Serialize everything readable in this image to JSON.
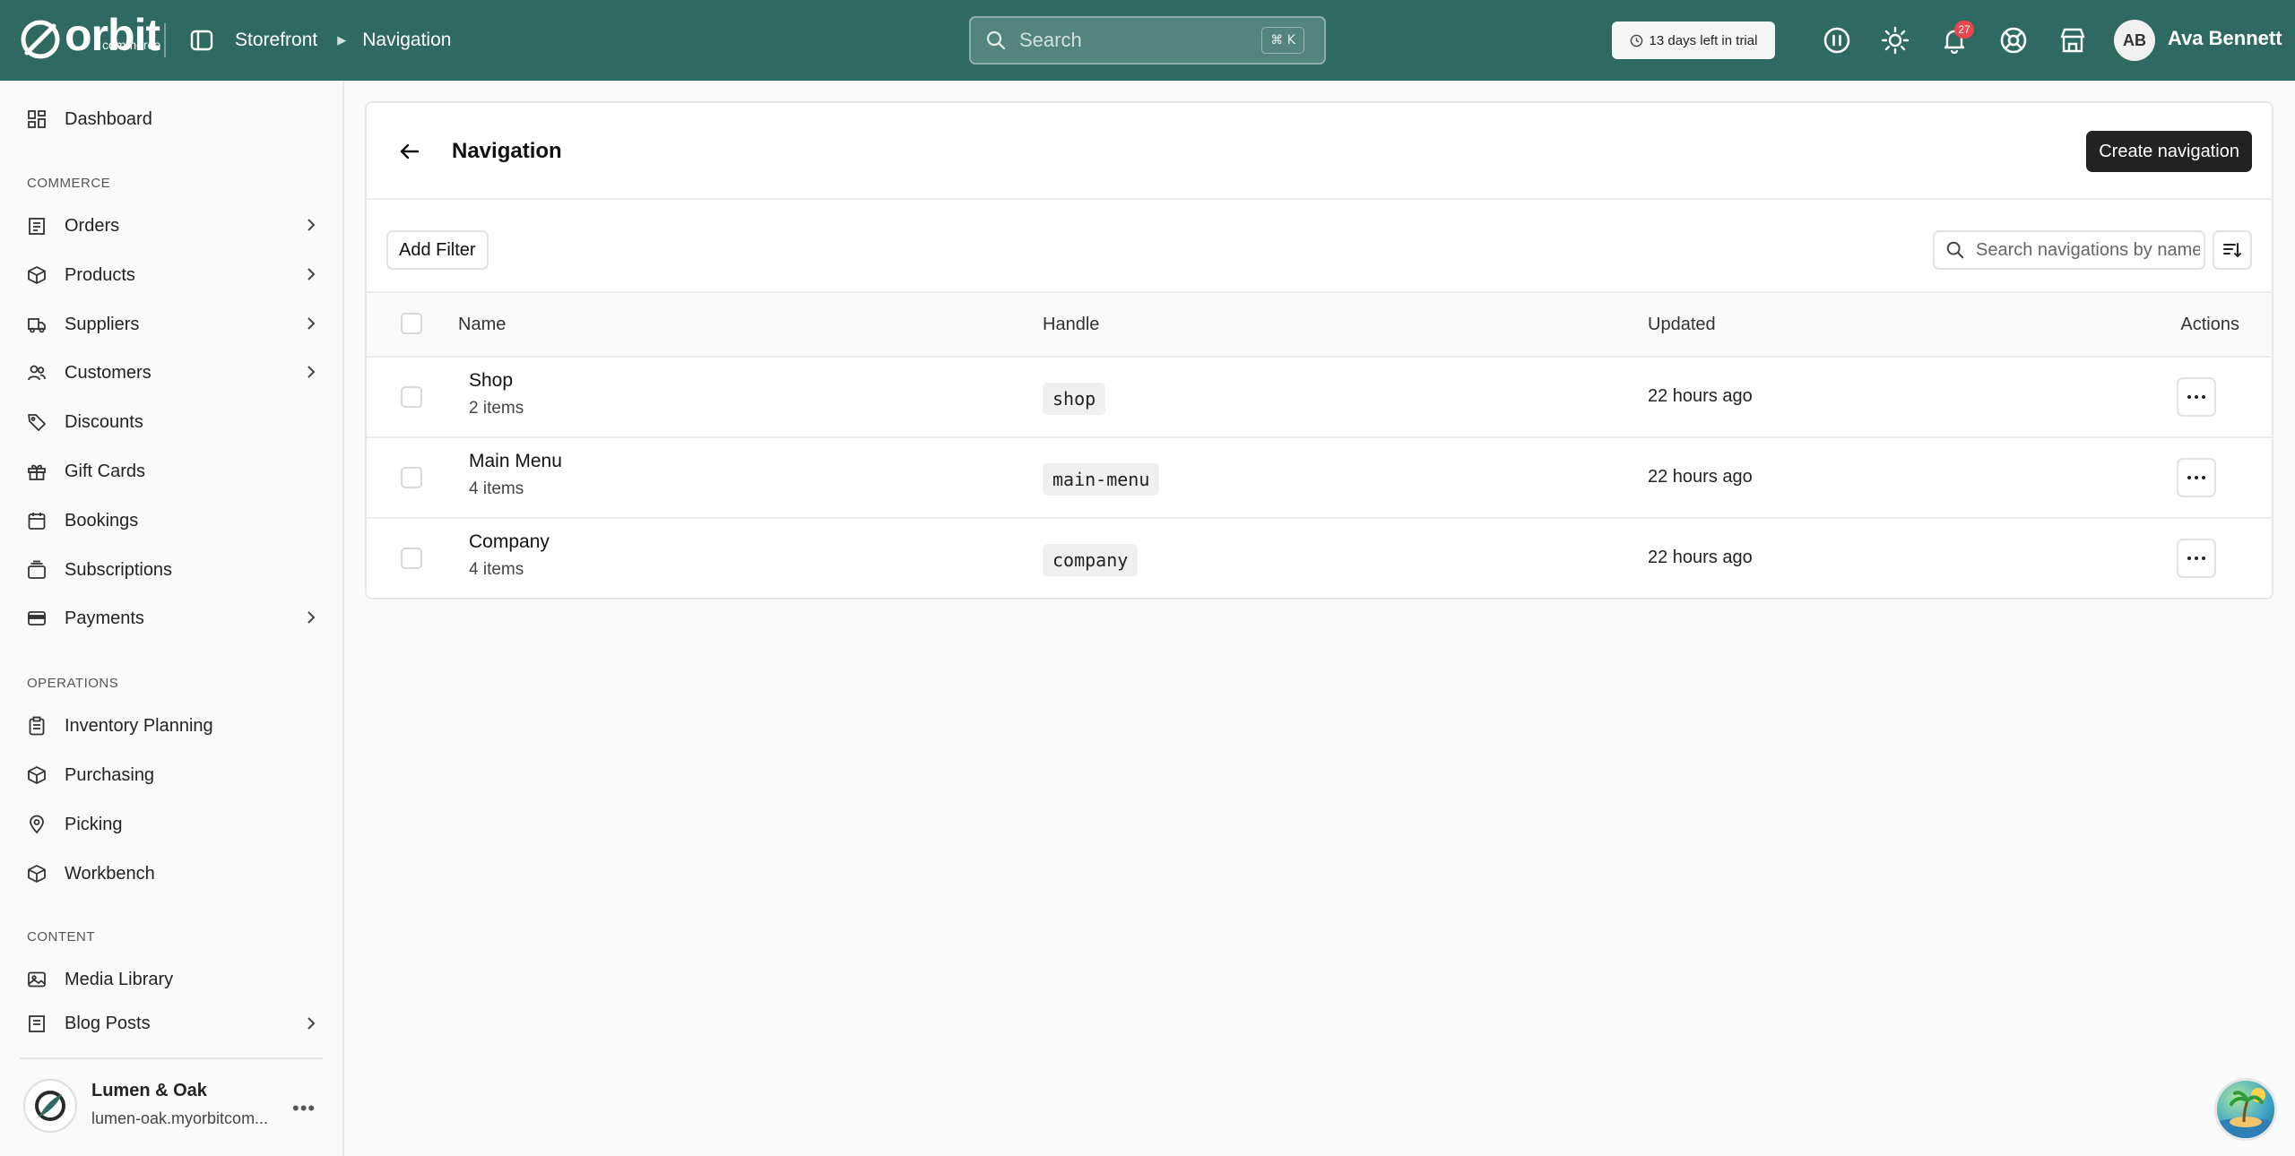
{
  "app": {
    "logo_text": "orbit",
    "logo_sub": "commerce",
    "breadcrumbs": [
      "Storefront",
      "Navigation"
    ],
    "search_placeholder": "Search",
    "search_shortcut": "⌘ K",
    "trial_text": "13 days left in trial",
    "notifications_count": "27",
    "user_initials": "AB",
    "user_name": "Ava Bennett",
    "brand_color": "#2e6a62"
  },
  "sidebar": {
    "items_top": [
      {
        "label": "Dashboard",
        "icon": "dashboard-icon",
        "chevron": false
      }
    ],
    "section_commerce": "COMMERCE",
    "commerce": [
      {
        "label": "Orders",
        "icon": "orders-icon",
        "chevron": true
      },
      {
        "label": "Products",
        "icon": "products-icon",
        "chevron": true
      },
      {
        "label": "Suppliers",
        "icon": "suppliers-icon",
        "chevron": true
      },
      {
        "label": "Customers",
        "icon": "customers-icon",
        "chevron": true
      },
      {
        "label": "Discounts",
        "icon": "discounts-icon",
        "chevron": false
      },
      {
        "label": "Gift Cards",
        "icon": "gift-icon",
        "chevron": false
      },
      {
        "label": "Bookings",
        "icon": "calendar-icon",
        "chevron": false
      },
      {
        "label": "Subscriptions",
        "icon": "subscriptions-icon",
        "chevron": false
      },
      {
        "label": "Payments",
        "icon": "payments-icon",
        "chevron": true
      }
    ],
    "section_operations": "OPERATIONS",
    "operations": [
      {
        "label": "Inventory Planning",
        "icon": "clipboard-icon",
        "chevron": false
      },
      {
        "label": "Purchasing",
        "icon": "purchasing-icon",
        "chevron": false
      },
      {
        "label": "Picking",
        "icon": "map-pin-icon",
        "chevron": false
      },
      {
        "label": "Workbench",
        "icon": "workbench-icon",
        "chevron": false
      }
    ],
    "section_content": "CONTENT",
    "content": [
      {
        "label": "Media Library",
        "icon": "image-icon",
        "chevron": false
      },
      {
        "label": "Blog Posts",
        "icon": "blog-icon",
        "chevron": true
      }
    ],
    "store": {
      "name": "Lumen & Oak",
      "url": "lumen-oak.myorbitcom..."
    }
  },
  "main": {
    "title": "Navigation",
    "create_label": "Create navigation",
    "add_filter_label": "Add Filter",
    "search_placeholder": "Search navigations by name",
    "columns": {
      "name": "Name",
      "handle": "Handle",
      "updated": "Updated",
      "actions": "Actions"
    },
    "rows": [
      {
        "name": "Shop",
        "count": "2 items",
        "handle": "shop",
        "updated": "22 hours ago"
      },
      {
        "name": "Main Menu",
        "count": "4 items",
        "handle": "main-menu",
        "updated": "22 hours ago"
      },
      {
        "name": "Company",
        "count": "4 items",
        "handle": "company",
        "updated": "22 hours ago"
      }
    ]
  }
}
